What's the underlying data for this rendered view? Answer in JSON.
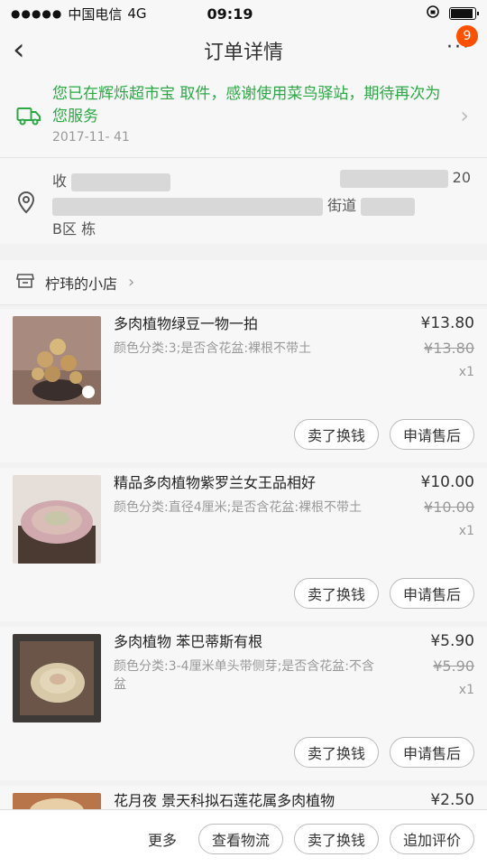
{
  "status_bar": {
    "carrier": "中国电信",
    "network": "4G",
    "time": "09:19"
  },
  "nav": {
    "title": "订单详情",
    "badge_count": "9"
  },
  "logistics": {
    "message": "您已在辉烁超市宝 取件，感谢使用菜鸟驿站，期待再次为您服务",
    "date": "2017-11-      41"
  },
  "address": {
    "prefix": "收",
    "tail": "20",
    "street": "街道",
    "building": "B区 栋"
  },
  "shop": {
    "name": "柠玮的小店"
  },
  "items": [
    {
      "name": "多肉植物绿豆一物一拍",
      "spec": "颜色分类:3;是否含花盆:裸根不带土",
      "price": "¥13.80",
      "original_price": "¥13.80",
      "qty": "x1",
      "btn_sell": "卖了换钱",
      "btn_after": "申请售后"
    },
    {
      "name": "精品多肉植物紫罗兰女王品相好",
      "spec": "颜色分类:直径4厘米;是否含花盆:裸根不带土",
      "price": "¥10.00",
      "original_price": "¥10.00",
      "qty": "x1",
      "btn_sell": "卖了换钱",
      "btn_after": "申请售后"
    },
    {
      "name": "多肉植物 苯巴蒂斯有根",
      "spec": "颜色分类:3-4厘米单头带侧芽;是否含花盆:不含盆",
      "price": "¥5.90",
      "original_price": "¥5.90",
      "qty": "x1",
      "btn_sell": "卖了换钱",
      "btn_after": "申请售后"
    },
    {
      "name": "花月夜 景天科拟石莲花属多肉植物",
      "price": "¥2.50"
    }
  ],
  "footer": {
    "more": "更多",
    "logistics": "查看物流",
    "sell": "卖了换钱",
    "review": "追加评价"
  },
  "colors": {
    "accent_green": "#2aa944",
    "badge_orange": "#ff5000"
  }
}
